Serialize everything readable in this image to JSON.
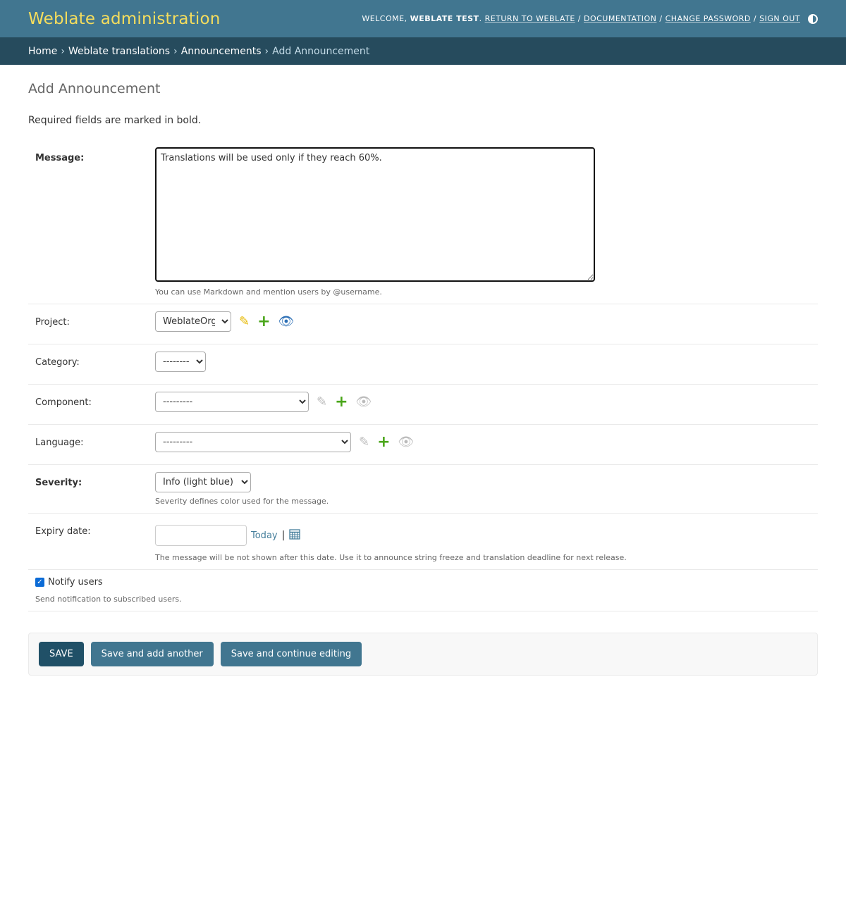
{
  "header": {
    "site_name": "Weblate administration",
    "welcome": "Welcome,",
    "username": "Weblate Test",
    "links": [
      "Return to Weblate",
      "Documentation",
      "Change password",
      "Sign out"
    ]
  },
  "breadcrumbs": {
    "items": [
      "Home",
      "Weblate translations",
      "Announcements"
    ],
    "current": "Add Announcement"
  },
  "page": {
    "title": "Add Announcement",
    "required_note": "Required fields are marked in bold."
  },
  "form": {
    "message": {
      "label": "Message:",
      "value": "Translations will be used only if they reach 60%.",
      "help": "You can use Markdown and mention users by @username."
    },
    "project": {
      "label": "Project:",
      "value": "WeblateOrg"
    },
    "category": {
      "label": "Category:",
      "value": "---------"
    },
    "component": {
      "label": "Component:",
      "value": "---------"
    },
    "language": {
      "label": "Language:",
      "value": "---------"
    },
    "severity": {
      "label": "Severity:",
      "value": "Info (light blue)",
      "help": "Severity defines color used for the message."
    },
    "expiry": {
      "label": "Expiry date:",
      "value": "",
      "today": "Today",
      "help": "The message will be not shown after this date. Use it to announce string freeze and translation deadline for next release."
    },
    "notify": {
      "label": "Notify users",
      "checked": true,
      "help": "Send notification to subscribed users."
    }
  },
  "buttons": {
    "save": "Save",
    "save_add": "Save and add another",
    "save_continue": "Save and continue editing"
  },
  "icons": {
    "edit": "pencil-icon",
    "add": "plus-icon",
    "view": "eye-icon",
    "calendar": "calendar-icon",
    "theme": "theme-toggle-icon"
  },
  "colors": {
    "header_bg": "#417690",
    "breadcrumb_bg": "#264b5d",
    "site_name": "#f5dd5d"
  }
}
